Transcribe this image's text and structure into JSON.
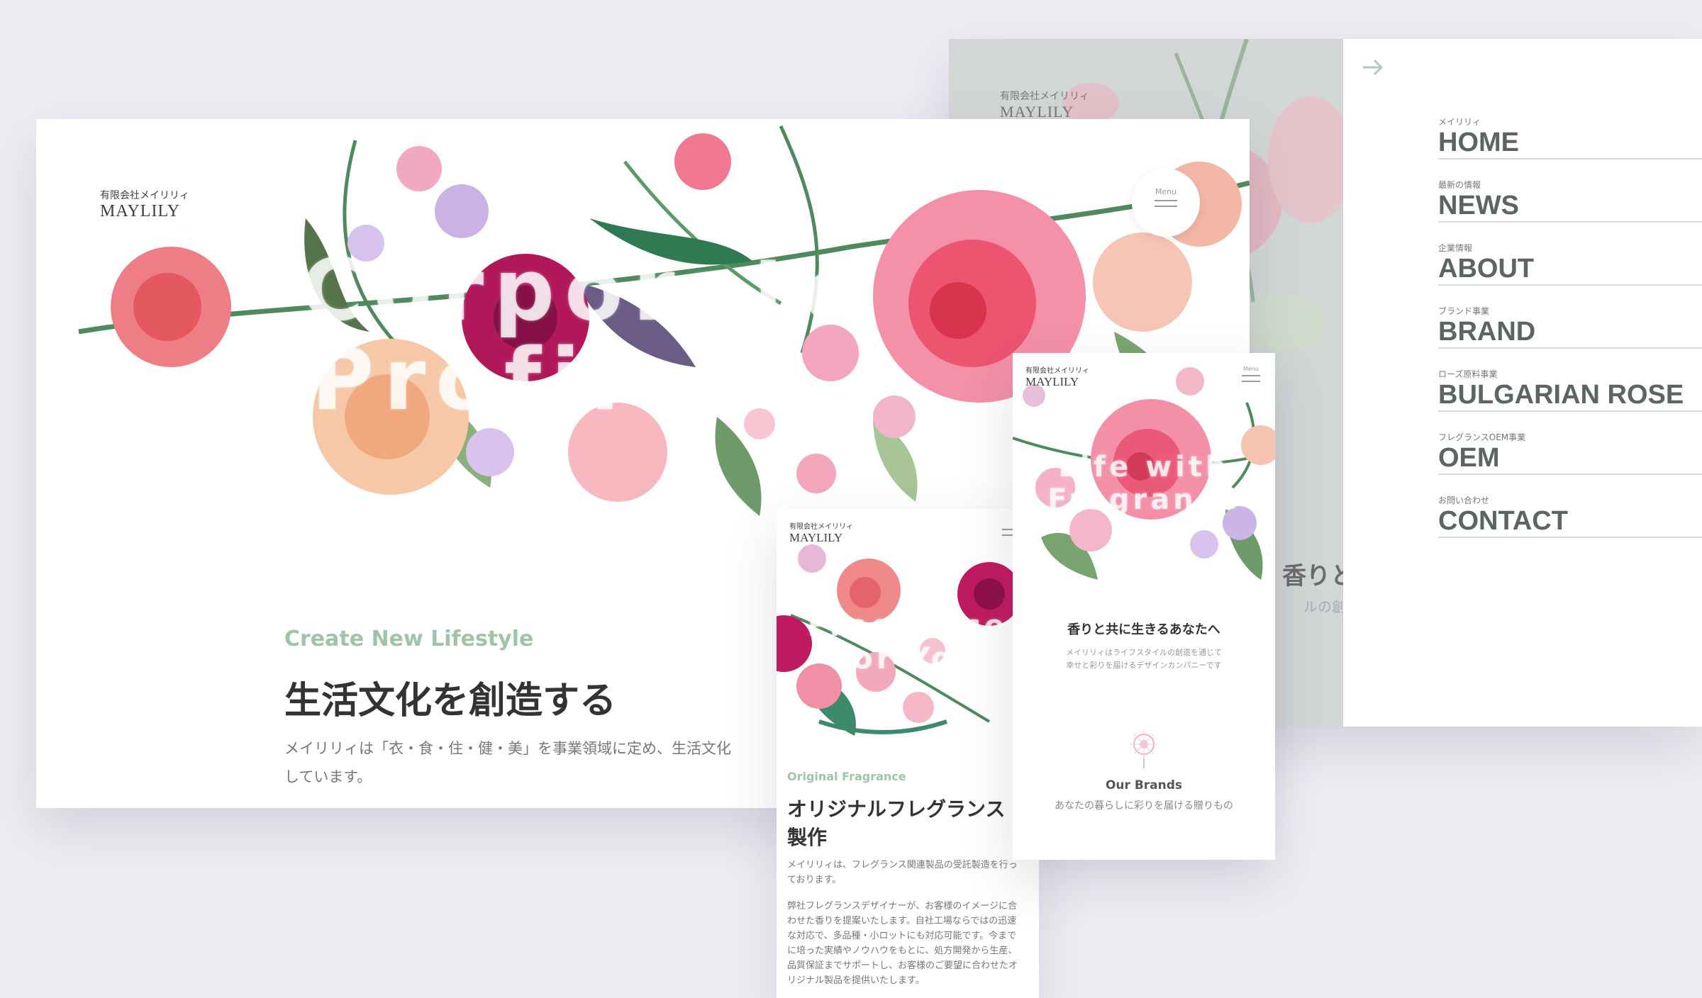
{
  "back_panel": {
    "logo_company": "有限会社メイリリィ",
    "logo_name": "MAYLILY",
    "peek_text": "香りと",
    "peek_sub": "ルの創造",
    "nav_items": [
      {
        "sub": "メイリリィ",
        "label": "HOME"
      },
      {
        "sub": "最新の情報",
        "label": "NEWS"
      },
      {
        "sub": "企業情報",
        "label": "ABOUT"
      },
      {
        "sub": "ブランド事業",
        "label": "BRAND"
      },
      {
        "sub": "ローズ原料事業",
        "label": "BULGARIAN ROSE"
      },
      {
        "sub": "フレグランスOEM事業",
        "label": "OEM"
      },
      {
        "sub": "お問い合わせ",
        "label": "CONTACT"
      }
    ]
  },
  "desktop": {
    "logo_company": "有限会社メイリリィ",
    "logo_name": "MAYLILY",
    "menu_label": "Menu",
    "hero_line1": "Corporate",
    "hero_line2": "Profile",
    "tagline_en": "Create New Lifestyle",
    "heading": "生活文化を創造する",
    "body_line1": "メイリリィは「衣・食・住・健・美」を事業領域に定め、生活文化",
    "body_line2": "しています。"
  },
  "mobile1": {
    "logo_company": "有限会社メイリリィ",
    "logo_name": "MAYLILY",
    "hero_line1": "Fragrance",
    "hero_line2": "for You",
    "label_en": "Original Fragrance",
    "heading_line1": "オリジナルフレグランス",
    "heading_line2": "製作",
    "para1": "メイリリィは、フレグランス関連製品の受託製造を行っております。",
    "para2": "弊社フレグランスデザイナーが、お客様のイメージに合わせた香りを提案いたします。自社工場ならではの迅速な対応で、多品種・小ロットにも対応可能です。今までに培った実績やノウハウをもとに、処方開発から生産、品質保証までサポートし、お客様のご要望に合わせたオリジナル製品を提供いたします。"
  },
  "mobile2": {
    "logo_company": "有限会社メイリリィ",
    "logo_name": "MAYLILY",
    "menu_label": "Menu",
    "hero_line1": "Life with",
    "hero_line2": "Fragrance",
    "heading": "香りと共に生きるあなたへ",
    "sub_line1": "メイリリィはライフスタイルの創造を通じて",
    "sub_line2": "幸せと彩りを届けるデザインカンパニーです",
    "brands_title": "Our Brands",
    "brands_sub": "あなたの暮らしに彩りを届ける贈りもの"
  },
  "colors": {
    "accent_green": "#9fc4a8",
    "nav_text": "#5b6660",
    "flower_pink": "#f07f9a",
    "flower_magenta": "#b0185a",
    "flower_peach": "#f6c2a0",
    "leaf_green": "#6f9b6b"
  }
}
